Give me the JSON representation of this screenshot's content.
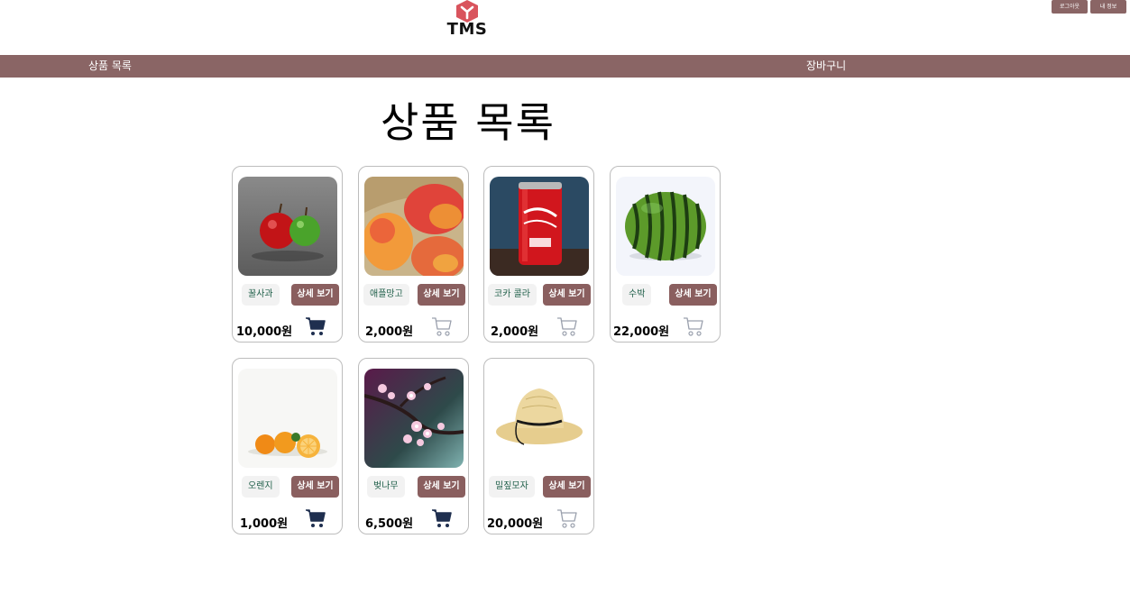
{
  "header": {
    "logo_text": "TMS",
    "logout_label": "로그아웃",
    "myinfo_label": "내 정보"
  },
  "nav": {
    "products_label": "상품 목록",
    "cart_label": "장바구니"
  },
  "page": {
    "title": "상품 목록"
  },
  "products": [
    {
      "name": "꿀사과",
      "detail_label": "상세 보기",
      "price": "10,000원",
      "cart_state": "filled"
    },
    {
      "name": "애플망고",
      "detail_label": "상세 보기",
      "price": "2,000원",
      "cart_state": "outline"
    },
    {
      "name": "코카 콜라",
      "detail_label": "상세 보기",
      "price": "2,000원",
      "cart_state": "outline"
    },
    {
      "name": "수박",
      "detail_label": "상세 보기",
      "price": "22,000원",
      "cart_state": "outline"
    },
    {
      "name": "오렌지",
      "detail_label": "상세 보기",
      "price": "1,000원",
      "cart_state": "filled"
    },
    {
      "name": "벚나무",
      "detail_label": "상세 보기",
      "price": "6,500원",
      "cart_state": "filled"
    },
    {
      "name": "밀짚모자",
      "detail_label": "상세 보기",
      "price": "20,000원",
      "cart_state": "outline"
    }
  ],
  "colors": {
    "brand": "#8a6565",
    "button": "#8a5f5f",
    "chip_text": "#1e5e48",
    "cart_filled": "#1f2f4f",
    "cart_outline": "#9aa0ad"
  }
}
